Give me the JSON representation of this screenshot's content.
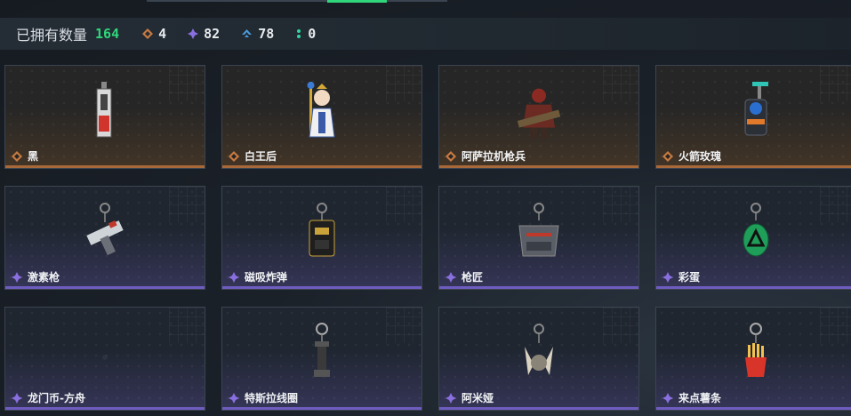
{
  "stats": {
    "owned_label": "已拥有数量",
    "owned_count": "164",
    "orange_count": "4",
    "purple_count": "82",
    "blue_count": "78",
    "green_count": "0"
  },
  "colors": {
    "accent_green": "#2fd67a",
    "orange_rarity": "#c97a3f",
    "purple_rarity": "#8a6fe0",
    "blue_rarity": "#4a9ad9",
    "green_rarity": "#2fd6a0"
  },
  "items": [
    {
      "name": "黑",
      "rarity": "orange",
      "icon": "vial-charm-icon"
    },
    {
      "name": "白王后",
      "rarity": "orange",
      "icon": "queen-figure-icon"
    },
    {
      "name": "阿萨拉机枪兵",
      "rarity": "orange",
      "icon": "gunner-figure-icon"
    },
    {
      "name": "火箭玫瑰",
      "rarity": "orange",
      "icon": "rocket-rose-icon"
    },
    {
      "name": "激素枪",
      "rarity": "purple",
      "icon": "injector-gun-icon"
    },
    {
      "name": "磁吸炸弹",
      "rarity": "purple",
      "icon": "magnet-bomb-icon"
    },
    {
      "name": "枪匠",
      "rarity": "purple",
      "icon": "gunsmith-case-icon"
    },
    {
      "name": "彩蛋",
      "rarity": "purple",
      "icon": "easter-egg-icon"
    },
    {
      "name": "龙门币-方舟",
      "rarity": "purple",
      "icon": "coin-icon"
    },
    {
      "name": "特斯拉线圈",
      "rarity": "purple",
      "icon": "tesla-coil-icon"
    },
    {
      "name": "阿米娅",
      "rarity": "purple",
      "icon": "amiya-charm-icon"
    },
    {
      "name": "来点薯条",
      "rarity": "purple",
      "icon": "fries-icon"
    }
  ]
}
